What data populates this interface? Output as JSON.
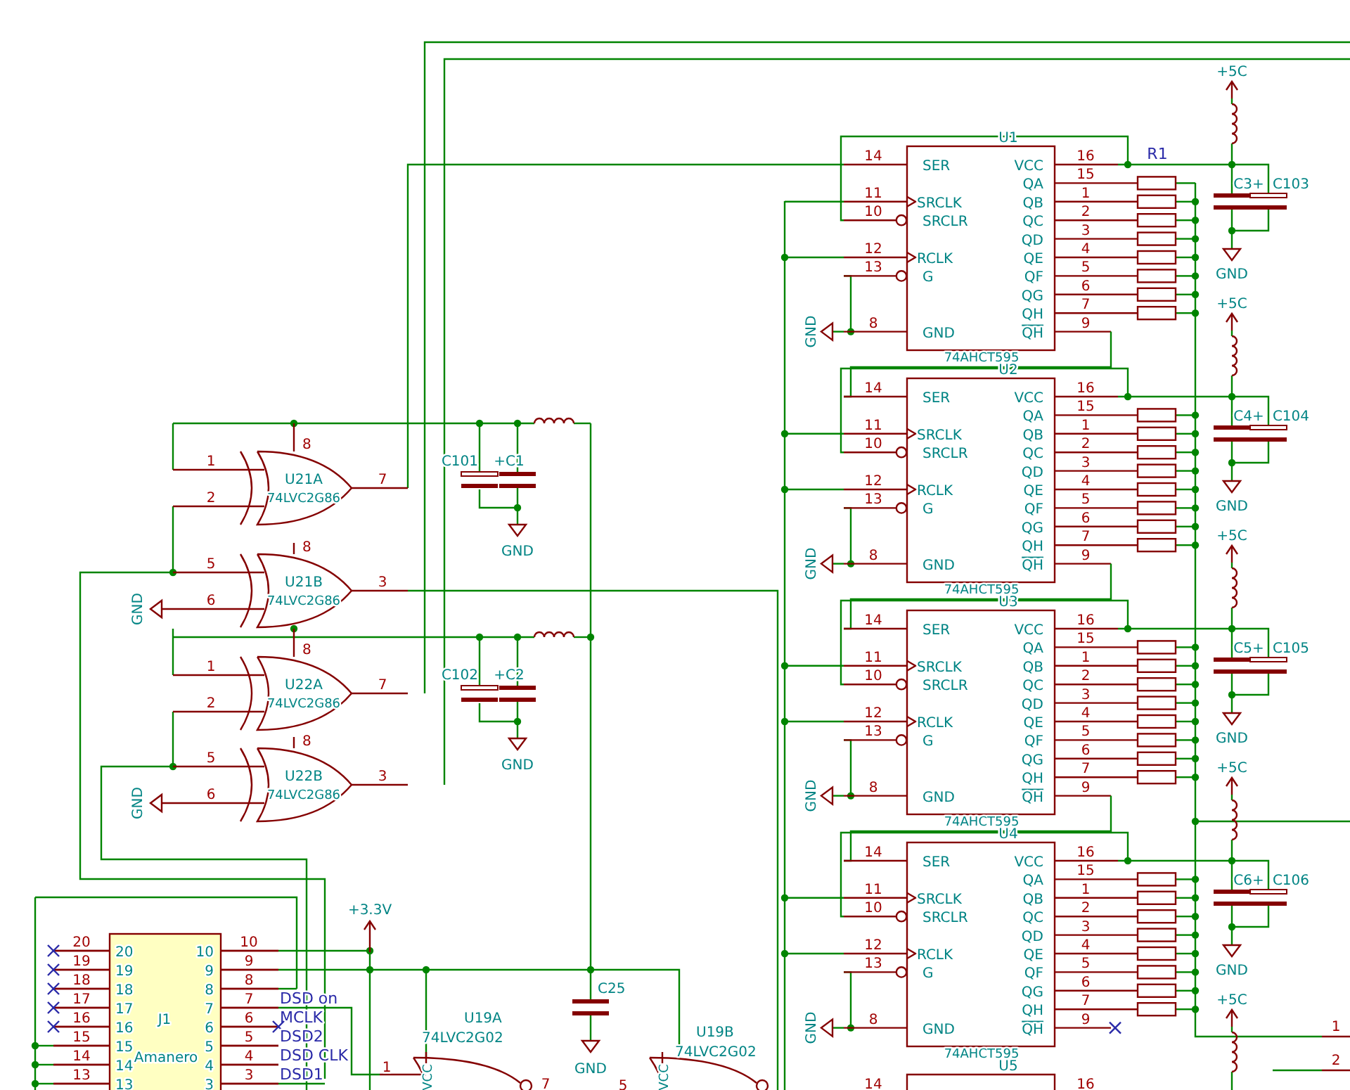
{
  "xor_gates": [
    {
      "ref": "U21A",
      "part": "74LVC2G86",
      "inputs": [
        "1",
        "2"
      ],
      "output": "7",
      "power_pin": "8"
    },
    {
      "ref": "U21B",
      "part": "74LVC2G86",
      "inputs": [
        "5",
        "6"
      ],
      "output": "3",
      "power_pin": "8",
      "grounded_input": "GND"
    },
    {
      "ref": "U22A",
      "part": "74LVC2G86",
      "inputs": [
        "1",
        "2"
      ],
      "output": "7",
      "power_pin": "8"
    },
    {
      "ref": "U22B",
      "part": "74LVC2G86",
      "inputs": [
        "5",
        "6"
      ],
      "output": "3",
      "power_pin": "8",
      "grounded_input": "GND"
    }
  ],
  "xor_decoupling": [
    {
      "caps": [
        "C101",
        "+C1"
      ],
      "ground": "GND"
    },
    {
      "caps": [
        "C102",
        "+C2"
      ],
      "ground": "GND"
    }
  ],
  "shift_registers": [
    {
      "ref": "U1",
      "part": "74AHCT595",
      "resistor_label": "R1",
      "qh_not_connected": false,
      "ground": "GND",
      "left_pins": [
        {
          "num": "14",
          "name": "SER",
          "kind": "plain"
        },
        {
          "num": "11",
          "name": "SRCLK",
          "kind": "clock"
        },
        {
          "num": "10",
          "name": "SRCLR",
          "kind": "inverted"
        },
        {
          "num": "12",
          "name": "RCLK",
          "kind": "clock"
        },
        {
          "num": "13",
          "name": "G",
          "kind": "inverted"
        },
        {
          "num": "8",
          "name": "GND",
          "kind": "plain"
        }
      ],
      "right_pins": [
        {
          "num": "16",
          "name": "VCC",
          "kind": "plain"
        },
        {
          "num": "15",
          "name": "QA",
          "kind": "plain"
        },
        {
          "num": "1",
          "name": "QB",
          "kind": "plain"
        },
        {
          "num": "2",
          "name": "QC",
          "kind": "plain"
        },
        {
          "num": "3",
          "name": "QD",
          "kind": "plain"
        },
        {
          "num": "4",
          "name": "QE",
          "kind": "plain"
        },
        {
          "num": "5",
          "name": "QF",
          "kind": "plain"
        },
        {
          "num": "6",
          "name": "QG",
          "kind": "plain"
        },
        {
          "num": "7",
          "name": "QH",
          "kind": "plain"
        },
        {
          "num": "9",
          "name": "QH",
          "kind": "overbar"
        }
      ],
      "supply": {
        "power": "+5C",
        "caps": [
          "C3+",
          "C103"
        ],
        "ground": "GND"
      }
    },
    {
      "ref": "U2",
      "part": "74AHCT595",
      "qh_not_connected": false,
      "ground": "GND",
      "left_pins": [
        {
          "num": "14",
          "name": "SER",
          "kind": "plain"
        },
        {
          "num": "11",
          "name": "SRCLK",
          "kind": "clock"
        },
        {
          "num": "10",
          "name": "SRCLR",
          "kind": "inverted"
        },
        {
          "num": "12",
          "name": "RCLK",
          "kind": "clock"
        },
        {
          "num": "13",
          "name": "G",
          "kind": "inverted"
        },
        {
          "num": "8",
          "name": "GND",
          "kind": "plain"
        }
      ],
      "right_pins": [
        {
          "num": "16",
          "name": "VCC",
          "kind": "plain"
        },
        {
          "num": "15",
          "name": "QA",
          "kind": "plain"
        },
        {
          "num": "1",
          "name": "QB",
          "kind": "plain"
        },
        {
          "num": "2",
          "name": "QC",
          "kind": "plain"
        },
        {
          "num": "3",
          "name": "QD",
          "kind": "plain"
        },
        {
          "num": "4",
          "name": "QE",
          "kind": "plain"
        },
        {
          "num": "5",
          "name": "QF",
          "kind": "plain"
        },
        {
          "num": "6",
          "name": "QG",
          "kind": "plain"
        },
        {
          "num": "7",
          "name": "QH",
          "kind": "plain"
        },
        {
          "num": "9",
          "name": "QH",
          "kind": "overbar"
        }
      ],
      "supply": {
        "power": "+5C",
        "caps": [
          "C4+",
          "C104"
        ],
        "ground": "GND"
      }
    },
    {
      "ref": "U3",
      "part": "74AHCT595",
      "qh_not_connected": false,
      "ground": "GND",
      "left_pins": [
        {
          "num": "14",
          "name": "SER",
          "kind": "plain"
        },
        {
          "num": "11",
          "name": "SRCLK",
          "kind": "clock"
        },
        {
          "num": "10",
          "name": "SRCLR",
          "kind": "inverted"
        },
        {
          "num": "12",
          "name": "RCLK",
          "kind": "clock"
        },
        {
          "num": "13",
          "name": "G",
          "kind": "inverted"
        },
        {
          "num": "8",
          "name": "GND",
          "kind": "plain"
        }
      ],
      "right_pins": [
        {
          "num": "16",
          "name": "VCC",
          "kind": "plain"
        },
        {
          "num": "15",
          "name": "QA",
          "kind": "plain"
        },
        {
          "num": "1",
          "name": "QB",
          "kind": "plain"
        },
        {
          "num": "2",
          "name": "QC",
          "kind": "plain"
        },
        {
          "num": "3",
          "name": "QD",
          "kind": "plain"
        },
        {
          "num": "4",
          "name": "QE",
          "kind": "plain"
        },
        {
          "num": "5",
          "name": "QF",
          "kind": "plain"
        },
        {
          "num": "6",
          "name": "QG",
          "kind": "plain"
        },
        {
          "num": "7",
          "name": "QH",
          "kind": "plain"
        },
        {
          "num": "9",
          "name": "QH",
          "kind": "overbar"
        }
      ],
      "supply": {
        "power": "+5C",
        "caps": [
          "C5+",
          "C105"
        ],
        "ground": "GND"
      }
    },
    {
      "ref": "U4",
      "part": "74AHCT595",
      "qh_not_connected": true,
      "ground": "GND",
      "left_pins": [
        {
          "num": "14",
          "name": "SER",
          "kind": "plain"
        },
        {
          "num": "11",
          "name": "SRCLK",
          "kind": "clock"
        },
        {
          "num": "10",
          "name": "SRCLR",
          "kind": "inverted"
        },
        {
          "num": "12",
          "name": "RCLK",
          "kind": "clock"
        },
        {
          "num": "13",
          "name": "G",
          "kind": "inverted"
        },
        {
          "num": "8",
          "name": "GND",
          "kind": "plain"
        }
      ],
      "right_pins": [
        {
          "num": "16",
          "name": "VCC",
          "kind": "plain"
        },
        {
          "num": "15",
          "name": "QA",
          "kind": "plain"
        },
        {
          "num": "1",
          "name": "QB",
          "kind": "plain"
        },
        {
          "num": "2",
          "name": "QC",
          "kind": "plain"
        },
        {
          "num": "3",
          "name": "QD",
          "kind": "plain"
        },
        {
          "num": "4",
          "name": "QE",
          "kind": "plain"
        },
        {
          "num": "5",
          "name": "QF",
          "kind": "plain"
        },
        {
          "num": "6",
          "name": "QG",
          "kind": "plain"
        },
        {
          "num": "7",
          "name": "QH",
          "kind": "plain"
        },
        {
          "num": "9",
          "name": "QH",
          "kind": "overbar"
        }
      ],
      "supply": {
        "power": "+5C",
        "caps": [
          "C6+",
          "C106"
        ],
        "ground": "GND"
      }
    },
    {
      "ref": "U5",
      "left_pins": [
        {
          "num": "14"
        }
      ],
      "right_pins": [
        {
          "num": "16"
        }
      ],
      "supply": {
        "power": "+5C"
      }
    }
  ],
  "connector": {
    "ref": "J1",
    "value": "Amanero",
    "left_pins": [
      {
        "outer": "20",
        "inner": "20",
        "unconnected": true
      },
      {
        "outer": "19",
        "inner": "19",
        "unconnected": true
      },
      {
        "outer": "18",
        "inner": "18",
        "unconnected": true
      },
      {
        "outer": "17",
        "inner": "17",
        "unconnected": true
      },
      {
        "outer": "16",
        "inner": "16",
        "unconnected": true
      },
      {
        "outer": "15",
        "inner": "15",
        "unconnected": false
      },
      {
        "outer": "14",
        "inner": "14",
        "unconnected": false
      },
      {
        "outer": "13",
        "inner": "13",
        "unconnected": false
      }
    ],
    "right_pins": [
      {
        "outer": "10",
        "inner": "10",
        "unconnected": false
      },
      {
        "outer": "9",
        "inner": "9",
        "unconnected": false
      },
      {
        "outer": "8",
        "inner": "8",
        "unconnected": false
      },
      {
        "outer": "7",
        "inner": "7",
        "net": "DSD on",
        "unconnected": false
      },
      {
        "outer": "6",
        "inner": "6",
        "net": "MCLK",
        "unconnected": true
      },
      {
        "outer": "5",
        "inner": "5",
        "net": "DSD2",
        "unconnected": false
      },
      {
        "outer": "4",
        "inner": "4",
        "net": "DSD CLK",
        "unconnected": false
      },
      {
        "outer": "3",
        "inner": "3",
        "net": "DSD1",
        "unconnected": false
      }
    ]
  },
  "logic_supply": {
    "power": "+3.3V"
  },
  "bypass_cap": {
    "ref": "C25",
    "ground": "GND"
  },
  "nor_gates": [
    {
      "ref": "U19A",
      "part": "74LVC2G02",
      "input": "1",
      "output": "7",
      "power_pin": "VCC"
    },
    {
      "ref": "U19B",
      "part": "74LVC2G02",
      "input": "5",
      "power_pin": "VCC"
    }
  ],
  "edge_pins": [
    "1",
    "2"
  ]
}
